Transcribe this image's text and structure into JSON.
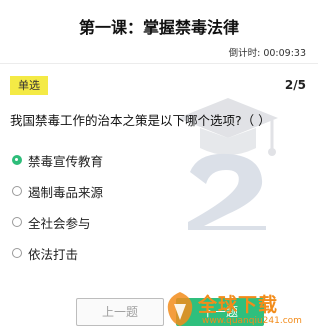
{
  "lesson": {
    "title": "第一课：掌握禁毒法律",
    "countdown_label": "倒计时:",
    "countdown_value": "00:09:33"
  },
  "question": {
    "type_label": "单选",
    "progress": "2/5",
    "text": "我国禁毒工作的治本之策是以下哪个选项?（ ）",
    "options": [
      {
        "label": "禁毒宣传教育",
        "selected": true
      },
      {
        "label": "遏制毒品来源",
        "selected": false
      },
      {
        "label": "全社会参与",
        "selected": false
      },
      {
        "label": "依法打击",
        "selected": false
      }
    ]
  },
  "nav": {
    "prev_label": "上一题",
    "next_label": "下一题"
  },
  "watermark": {
    "logo_text": "全球下载",
    "logo_url": "www.quanqiu241.com"
  },
  "colors": {
    "accent_green": "#2fbf7d",
    "badge_yellow": "#f4ea45",
    "logo_orange": "#f28c1b"
  }
}
